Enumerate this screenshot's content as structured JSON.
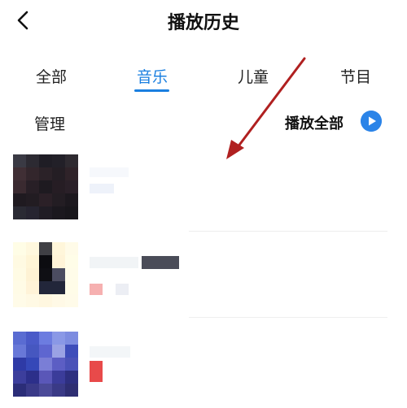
{
  "header": {
    "title": "播放历史"
  },
  "tabs": [
    {
      "label": "全部",
      "active": false
    },
    {
      "label": "音乐",
      "active": true
    },
    {
      "label": "儿童",
      "active": false
    },
    {
      "label": "节目",
      "active": false
    }
  ],
  "toolbar": {
    "manage_label": "管理",
    "play_all_label": "播放全部"
  },
  "colors": {
    "accent": "#1a7fe0",
    "annotation_arrow": "#b02020"
  },
  "icons": {
    "back": "chevron-left-icon",
    "play": "play-circle-icon"
  },
  "list": [
    {
      "thumb_palette": [
        "#3a3a44",
        "#2c2a32",
        "#1f1d25",
        "#222028",
        "#2e2a30",
        "#402f35",
        "#33262c",
        "#2b2228",
        "#241e24",
        "#2f2329",
        "#3a2a30",
        "#281f26",
        "#1e1a20",
        "#261d24",
        "#2a2028",
        "#1f1a20",
        "#221c22",
        "#2b2027",
        "#231d23",
        "#1c181e",
        "#2a2a33",
        "#262430",
        "#201c24",
        "#1b181e",
        "#18161b"
      ]
    },
    {
      "thumb_palette": [
        "#fffde6",
        "#fff8de",
        "#3f3f44",
        "#fff6da",
        "#fffbe8",
        "#fffae2",
        "#fff5d6",
        "#0c0c10",
        "#fff4d8",
        "#fffde8",
        "#fffbe4",
        "#fef2d4",
        "#0f0f14",
        "#4b4c60",
        "#fffce9",
        "#fffbe6",
        "#fff3d8",
        "#22263a",
        "#22263a",
        "#fffce8",
        "#fffbe8",
        "#fff9e4",
        "#fff7e0",
        "#fff9e6",
        "#fffbe9"
      ]
    },
    {
      "thumb_palette": [
        "#5a6cd2",
        "#4a5ac8",
        "#6c7ce0",
        "#8a98e6",
        "#7d8ce0",
        "#6878d8",
        "#4657c0",
        "#5e66d0",
        "#9aa2e4",
        "#3e4dba",
        "#2e3aa6",
        "#3548b8",
        "#7a7ed6",
        "#5c5ec4",
        "#4a52b8",
        "#3c3e9c",
        "#2c2f8a",
        "#5a57b8",
        "#3b3c9a",
        "#2d2f80",
        "#2b2d78",
        "#3a3a88",
        "#4b4a98",
        "#3a3a86",
        "#2e2e72"
      ]
    }
  ]
}
